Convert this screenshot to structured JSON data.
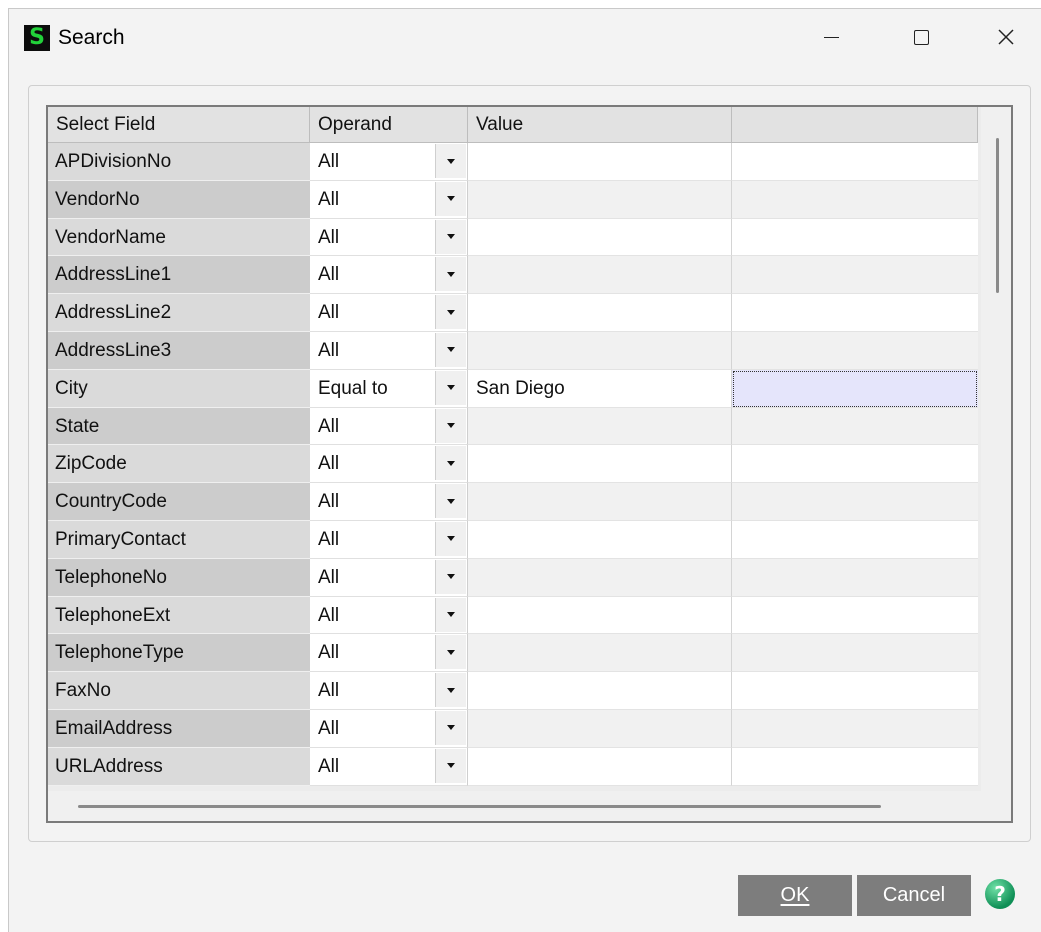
{
  "window": {
    "title": "Search",
    "app_icon_letter": "S"
  },
  "grid": {
    "columns": [
      "Select Field",
      "Operand",
      "Value",
      ""
    ],
    "rows": [
      {
        "field": "APDivisionNo",
        "operand": "All",
        "value": ""
      },
      {
        "field": "VendorNo",
        "operand": "All",
        "value": ""
      },
      {
        "field": "VendorName",
        "operand": "All",
        "value": ""
      },
      {
        "field": "AddressLine1",
        "operand": "All",
        "value": ""
      },
      {
        "field": "AddressLine2",
        "operand": "All",
        "value": ""
      },
      {
        "field": "AddressLine3",
        "operand": "All",
        "value": ""
      },
      {
        "field": "City",
        "operand": "Equal to",
        "value": "San Diego"
      },
      {
        "field": "State",
        "operand": "All",
        "value": ""
      },
      {
        "field": "ZipCode",
        "operand": "All",
        "value": ""
      },
      {
        "field": "CountryCode",
        "operand": "All",
        "value": ""
      },
      {
        "field": "PrimaryContact",
        "operand": "All",
        "value": ""
      },
      {
        "field": "TelephoneNo",
        "operand": "All",
        "value": ""
      },
      {
        "field": "TelephoneExt",
        "operand": "All",
        "value": ""
      },
      {
        "field": "TelephoneType",
        "operand": "All",
        "value": ""
      },
      {
        "field": "FaxNo",
        "operand": "All",
        "value": ""
      },
      {
        "field": "EmailAddress",
        "operand": "All",
        "value": ""
      },
      {
        "field": "URLAddress",
        "operand": "All",
        "value": ""
      }
    ],
    "focused_row_index": 6
  },
  "buttons": {
    "ok": "OK",
    "cancel": "Cancel",
    "help_glyph": "?"
  },
  "colors": {
    "button_bg": "#7d7d7d",
    "focus_cell": "#e5e5fb",
    "help_green": "#0f8f56"
  }
}
